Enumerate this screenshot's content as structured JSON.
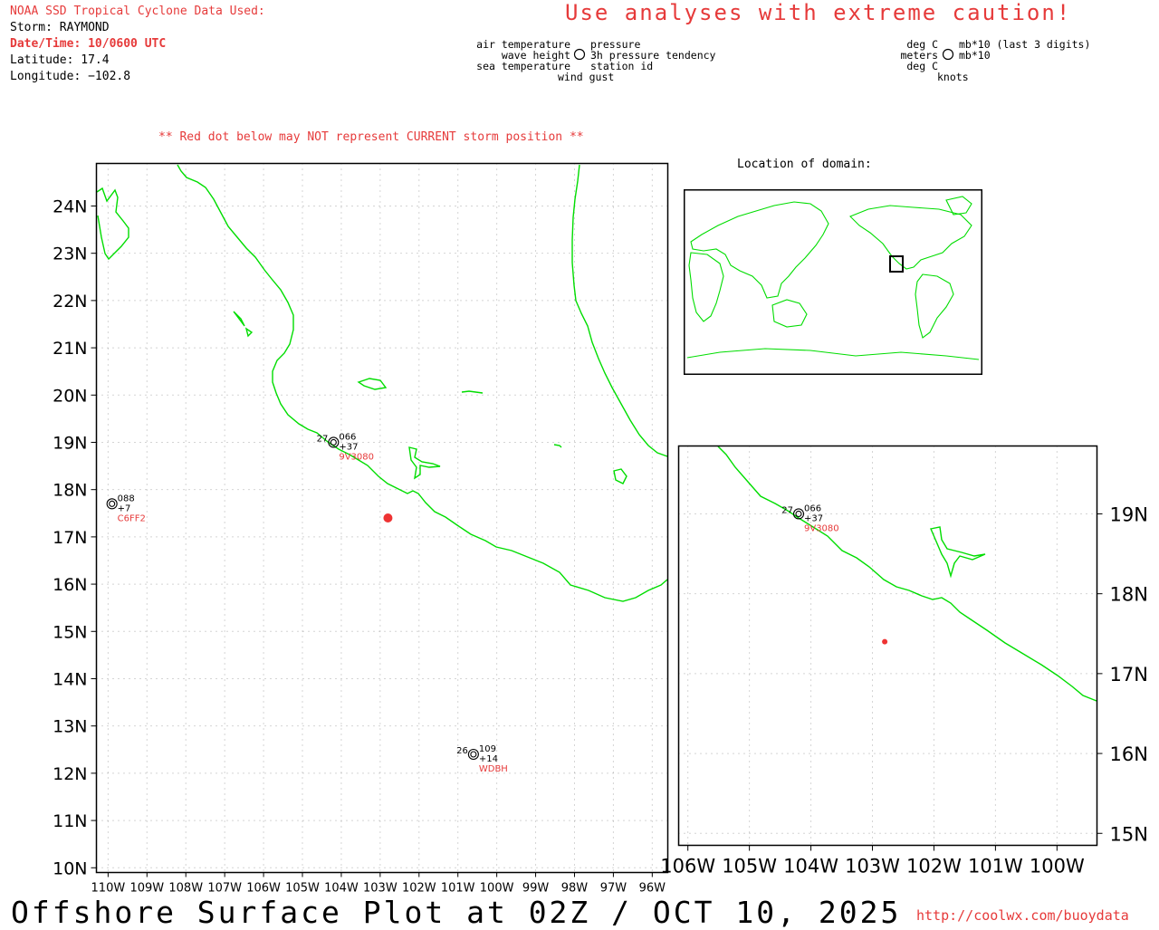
{
  "header": {
    "source_title": "NOAA SSD Tropical Cyclone Data Used:",
    "storm": "Storm: RAYMOND",
    "datetime": "Date/Time: 10/0600 UTC",
    "latitude": "Latitude: 17.4",
    "longitude": "Longitude: −102.8",
    "caution": "Use analyses with extreme caution!",
    "red_dot_note": "** Red dot below may NOT represent CURRENT storm position **"
  },
  "legend": {
    "left": [
      "air temperature",
      "wave height",
      "sea temperature"
    ],
    "center_bottom": "wind gust",
    "right": [
      "pressure",
      "3h pressure tendency",
      "station id"
    ],
    "units_left": [
      "deg C",
      "meters",
      "deg C"
    ],
    "units_right": [
      "mb*10 (last 3 digits)",
      "mb*10"
    ],
    "units_bottom": "knots"
  },
  "main_map": {
    "lat_labels": [
      "24N",
      "23N",
      "22N",
      "21N",
      "20N",
      "19N",
      "18N",
      "17N",
      "16N",
      "15N",
      "14N",
      "13N",
      "12N",
      "11N",
      "10N"
    ],
    "lon_labels": [
      "110W",
      "109W",
      "108W",
      "107W",
      "106W",
      "105W",
      "104W",
      "103W",
      "102W",
      "101W",
      "100W",
      "99W",
      "98W",
      "97W",
      "96W"
    ],
    "stations": [
      {
        "id": "9V3080",
        "air_temp": "27",
        "pressure": "066",
        "tendency": "+37",
        "lat": 19.0,
        "lon": -104.2
      },
      {
        "id": "C6FF2",
        "air_temp": "",
        "pressure": "088",
        "tendency": "+7",
        "lat": 17.7,
        "lon": -109.9
      },
      {
        "id": "WDBH",
        "air_temp": "26",
        "pressure": "109",
        "tendency": "+14",
        "lat": 12.4,
        "lon": -100.6
      }
    ],
    "storm_position": {
      "lat": 17.4,
      "lon": -102.8
    },
    "colors": {
      "coast": "#00dd00",
      "storm": "#ee3333",
      "grid": "#aaaaaa"
    }
  },
  "inset": {
    "title": "Location of domain:"
  },
  "zoom_map": {
    "lat_labels": [
      "19N",
      "18N",
      "17N",
      "16N",
      "15N"
    ],
    "lon_labels": [
      "106W",
      "105W",
      "104W",
      "103W",
      "102W",
      "101W",
      "100W"
    ],
    "stations": [
      {
        "id": "9V3080",
        "air_temp": "27",
        "pressure": "066",
        "tendency": "+37"
      }
    ]
  },
  "footer": {
    "title": "Offshore Surface Plot at 02Z / OCT 10, 2025",
    "url": "http://coolwx.com/buoydata"
  }
}
